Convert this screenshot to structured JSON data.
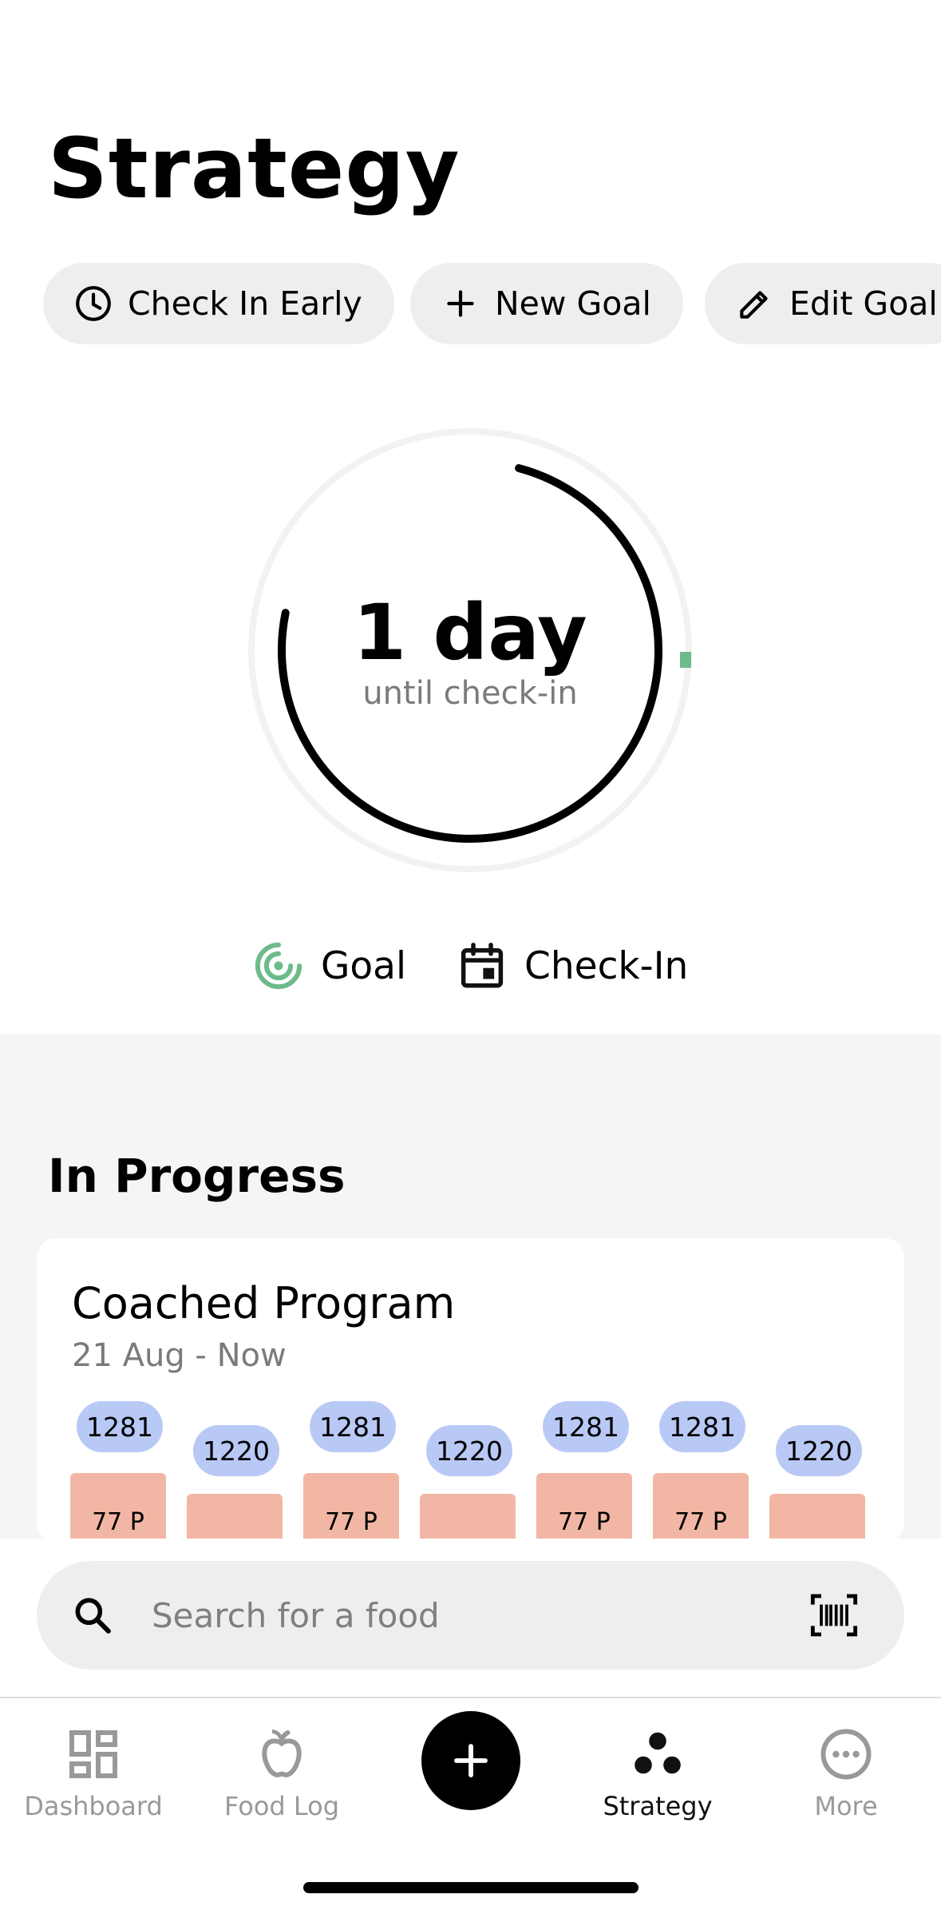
{
  "page": {
    "title": "Strategy"
  },
  "actions": [
    {
      "label": "Check In Early",
      "icon": "clock-icon"
    },
    {
      "label": "New Goal",
      "icon": "plus-icon"
    },
    {
      "label": "Edit Goal",
      "icon": "pencil-icon"
    }
  ],
  "countdown": {
    "value": "1 day",
    "caption": "until check-in",
    "ring_progress_fraction": 0.74
  },
  "legend": [
    {
      "label": "Goal",
      "icon": "target-icon",
      "color": "#6dbb8a"
    },
    {
      "label": "Check-In",
      "icon": "calendar-icon",
      "color": "#111111"
    }
  ],
  "in_progress": {
    "heading": "In Progress",
    "card": {
      "title": "Coached Program",
      "date_range": "21 Aug - Now",
      "days": [
        {
          "calories": "1281",
          "protein": "77 P"
        },
        {
          "calories": "1220",
          "protein": ""
        },
        {
          "calories": "1281",
          "protein": "77 P"
        },
        {
          "calories": "1220",
          "protein": ""
        },
        {
          "calories": "1281",
          "protein": "77 P"
        },
        {
          "calories": "1281",
          "protein": "77 P"
        },
        {
          "calories": "1220",
          "protein": ""
        }
      ]
    }
  },
  "search": {
    "placeholder": "Search for a food",
    "icon": "search-icon",
    "scan_icon": "barcode-icon"
  },
  "nav": {
    "items": [
      {
        "label": "Dashboard",
        "icon": "dashboard-icon"
      },
      {
        "label": "Food Log",
        "icon": "apple-icon"
      },
      {
        "label": "Strategy",
        "icon": "strategy-icon",
        "active": true
      },
      {
        "label": "More",
        "icon": "more-icon"
      }
    ],
    "add_icon": "plus-icon"
  },
  "colors": {
    "goal_green": "#6dbb8a",
    "calorie_pill": "#b9c9f6",
    "protein_bar": "#f2b7a4",
    "chip_bg": "#eeeeee"
  }
}
